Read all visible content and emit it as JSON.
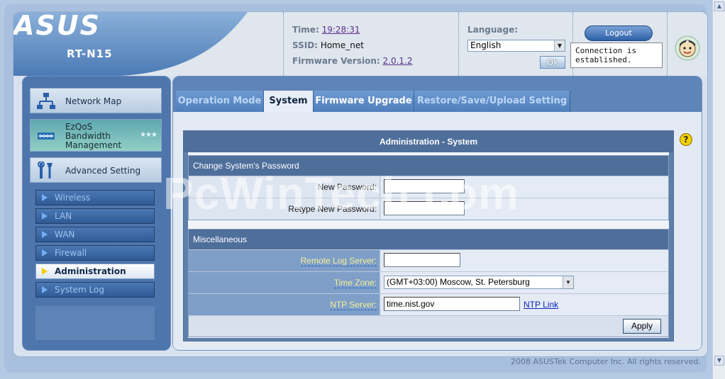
{
  "header": {
    "brand": "ASUS",
    "model": "RT-N15",
    "time_label": "Time:",
    "time_value": "19:28:31",
    "ssid_label": "SSID:",
    "ssid_value": "Home_net",
    "firmware_label": "Firmware Version:",
    "firmware_value": "2.0.1.2",
    "language_label": "Language:",
    "language_value": "English",
    "ok_label": "Ok",
    "logout_label": "Logout",
    "connection_status": "Connection is established."
  },
  "sidebar": {
    "main_items": [
      {
        "label": "Network Map",
        "icon": "network-map-icon"
      },
      {
        "label": "EzQoS Bandwidth Management",
        "icon": "ezqos-icon"
      },
      {
        "label": "Advanced Setting",
        "icon": "tools-icon"
      }
    ],
    "ezqos_lines": [
      "EzQoS",
      "Bandwidth",
      "Management"
    ],
    "sub_items": [
      {
        "label": "Wireless",
        "active": false
      },
      {
        "label": "LAN",
        "active": false
      },
      {
        "label": "WAN",
        "active": false
      },
      {
        "label": "Firewall",
        "active": false
      },
      {
        "label": "Administration",
        "active": true
      },
      {
        "label": "System Log",
        "active": false
      }
    ]
  },
  "tabs": [
    {
      "label": "Operation Mode",
      "active": false
    },
    {
      "label": "System",
      "active": true
    },
    {
      "label": "Firmware Upgrade",
      "active": false
    },
    {
      "label": "Restore/Save/Upload Setting",
      "active": false
    }
  ],
  "admin": {
    "title": "Administration - System",
    "password_section": {
      "heading": "Change System's Password",
      "new_password_label": "New Password:",
      "new_password_value": "",
      "retype_password_label": "Retype New Password:",
      "retype_password_value": ""
    },
    "misc_section": {
      "heading": "Miscellaneous",
      "remote_log_label": "Remote Log Server:",
      "remote_log_value": "",
      "timezone_label": "Time Zone:",
      "timezone_value": "(GMT+03:00) Moscow, St. Petersburg",
      "ntp_label": "NTP Server:",
      "ntp_value": "time.nist.gov",
      "ntp_link": "NTP Link"
    },
    "apply_label": "Apply"
  },
  "watermark": "PcWinTech.com",
  "footer": "2008 ASUSTek Computer Inc. All rights reserved.",
  "colors": {
    "accent_blue": "#4f6f9b",
    "link_label_yellow": "#f4ef96",
    "help_yellow": "#f2d000"
  }
}
